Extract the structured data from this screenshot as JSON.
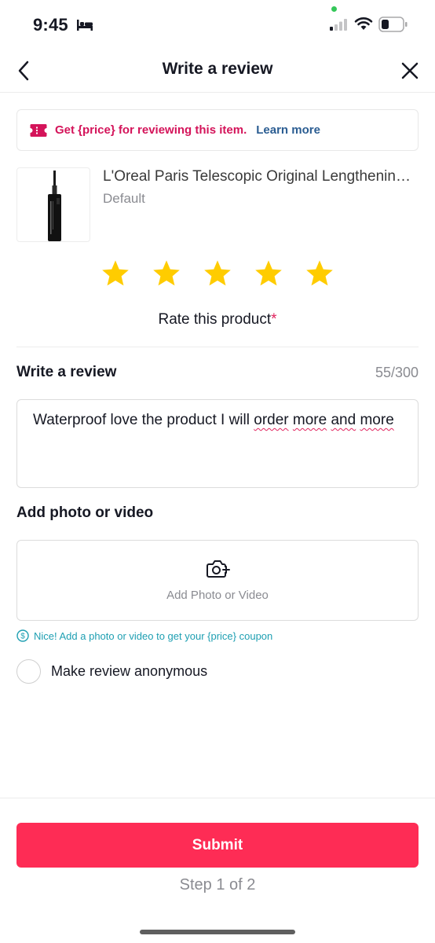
{
  "status_bar": {
    "time": "9:45",
    "icons": [
      "bed-icon",
      "signal-icon",
      "wifi-icon",
      "battery-icon"
    ]
  },
  "header": {
    "title": "Write a review",
    "back_icon": "chevron-left-icon",
    "close_icon": "close-icon"
  },
  "promo": {
    "text": "Get {price} for reviewing this item.",
    "link": "Learn more",
    "color": "#d4145a",
    "link_color": "#2b5d92"
  },
  "product": {
    "name": "L'Oreal Paris Telescopic Original Lengthening Mascara",
    "variant": "Default"
  },
  "rating": {
    "stars_selected": 5,
    "stars_total": 5,
    "label": "Rate this product",
    "required_mark": "*",
    "star_color": "#ffcc00"
  },
  "review": {
    "heading": "Write a review",
    "char_count": "55/300",
    "text_plain": "Waterproof love the product I will ",
    "text_spell_1": "order",
    "text_spell_2": "more",
    "text_spell_3": "and",
    "text_spell_4": "more"
  },
  "photo": {
    "heading": "Add photo or video",
    "button_label": "Add Photo or Video",
    "tip": "Nice! Add a photo or video to get your {price} coupon",
    "tip_color": "#1e9fb2"
  },
  "anonymous": {
    "label": "Make review anonymous",
    "checked": false
  },
  "footer": {
    "submit_label": "Submit",
    "step_label": "Step 1 of 2",
    "accent": "#fe2c55"
  }
}
